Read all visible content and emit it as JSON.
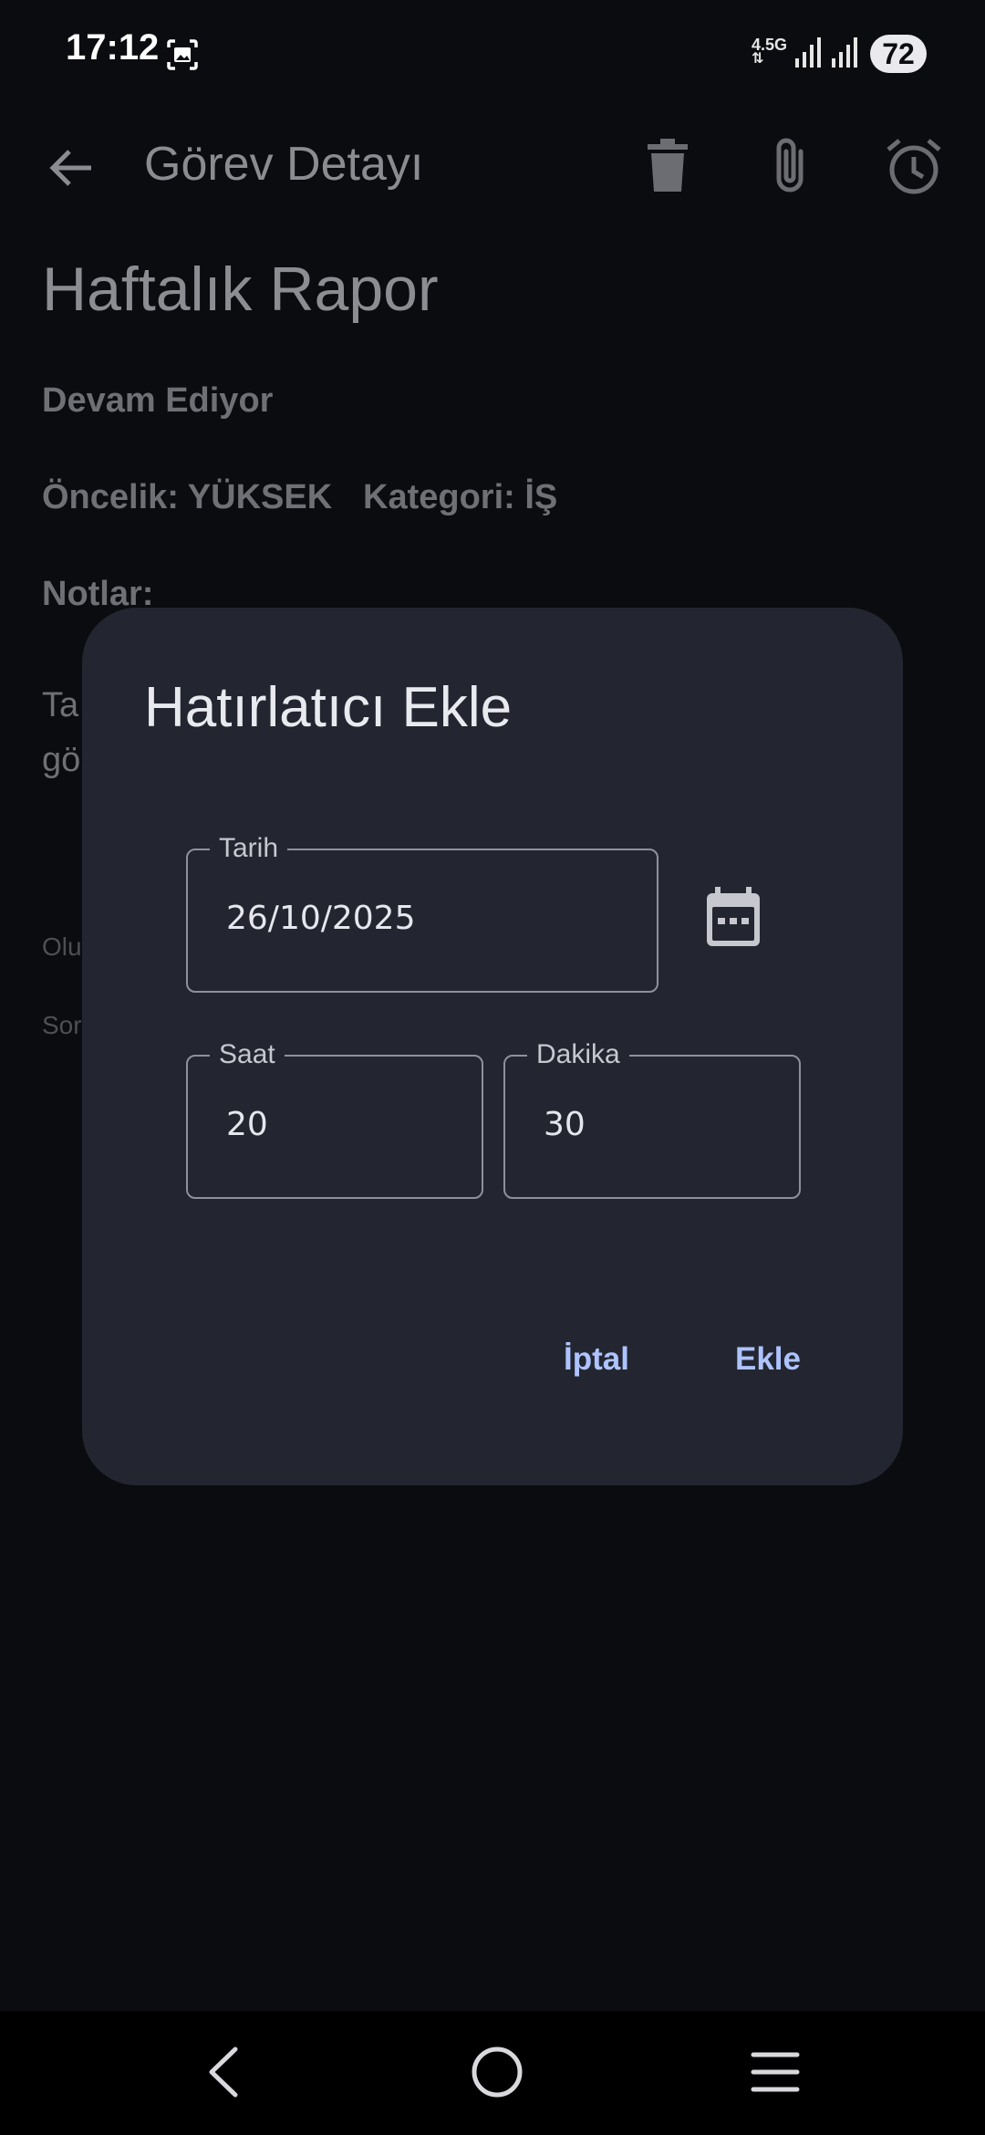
{
  "status_bar": {
    "time": "17:12",
    "network": "4.5G",
    "battery": "72",
    "icons": [
      "screenshot-icon",
      "signal-icon",
      "signal-icon"
    ]
  },
  "app_bar": {
    "title": "Görev Detayı",
    "icons": [
      "back-arrow-icon",
      "trash-icon",
      "paperclip-icon",
      "alarm-clock-icon"
    ]
  },
  "task": {
    "title": "Haftalık Rapor",
    "status": "Devam Ediyor",
    "priority": "Öncelik: YÜKSEK",
    "category": "Kategori: İŞ",
    "notes_label": "Notlar:",
    "notes_line_1": "Ta",
    "notes_line_2": "gö",
    "created_partial": "Olu",
    "updated_partial": "Sor"
  },
  "dialog": {
    "title": "Hatırlatıcı Ekle",
    "date": {
      "label": "Tarih",
      "value": "26/10/2025"
    },
    "hour": {
      "label": "Saat",
      "value": "20"
    },
    "minute": {
      "label": "Dakika",
      "value": "30"
    },
    "cancel_label": "İptal",
    "add_label": "Ekle",
    "accent_color": "#aec3ff",
    "surface_color": "#232630"
  },
  "nav_bar": {
    "icons": [
      "nav-back-icon",
      "nav-home-icon",
      "nav-menu-icon"
    ]
  }
}
